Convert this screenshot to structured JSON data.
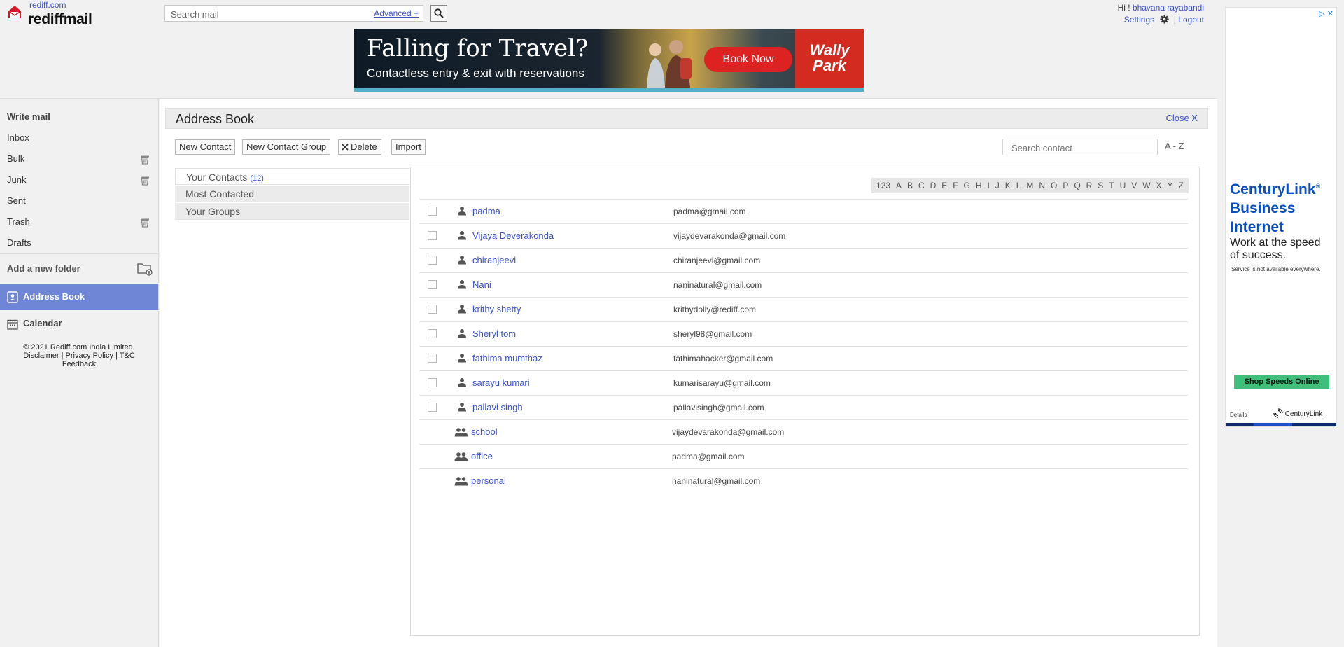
{
  "header": {
    "brand_small": "rediff.com",
    "brand_main": "rediffmail",
    "search_placeholder": "Search mail",
    "advanced_label": "Advanced +",
    "greeting": "Hi !",
    "user_name": "bhavana rayabandi",
    "settings_label": "Settings",
    "separator": "|",
    "logout_label": "Logout"
  },
  "top_ad": {
    "title": "Falling for Travel?",
    "subtitle": "Contactless entry & exit with reservations",
    "cta": "Book Now",
    "brand_line1": "Wally",
    "brand_line2": "Park"
  },
  "sidebar": {
    "write_mail": "Write mail",
    "items": [
      {
        "label": "Inbox",
        "trash": false
      },
      {
        "label": "Bulk",
        "trash": true
      },
      {
        "label": "Junk",
        "trash": true
      },
      {
        "label": "Sent",
        "trash": false
      },
      {
        "label": "Trash",
        "trash": true
      },
      {
        "label": "Drafts",
        "trash": false
      }
    ],
    "add_folder": "Add a new folder",
    "address_book": "Address Book",
    "calendar": "Calendar",
    "copyright": "© 2021 Rediff.com India Limited.",
    "disclaimer": "Disclaimer",
    "privacy": "Privacy Policy",
    "tc": "T&C",
    "feedback": "Feedback",
    "pipe": "|"
  },
  "address_book": {
    "title": "Address Book",
    "close_label": "Close X",
    "toolbar": {
      "new_contact": "New Contact",
      "new_group": "New Contact Group",
      "delete": "Delete",
      "import": "Import"
    },
    "search_placeholder": "Search contact",
    "sort_label": "A - Z",
    "tabs": {
      "your_contacts": "Your Contacts",
      "your_contacts_count": "(12)",
      "most_contacted": "Most Contacted",
      "your_groups": "Your Groups"
    },
    "alphabet": [
      "123",
      "A",
      "B",
      "C",
      "D",
      "E",
      "F",
      "G",
      "H",
      "I",
      "J",
      "K",
      "L",
      "M",
      "N",
      "O",
      "P",
      "Q",
      "R",
      "S",
      "T",
      "U",
      "V",
      "W",
      "X",
      "Y",
      "Z"
    ],
    "contacts": [
      {
        "name": "padma",
        "email": "padma@gmail.com",
        "type": "person"
      },
      {
        "name": "Vijaya Deverakonda",
        "email": "vijaydevarakonda@gmail.com",
        "type": "person"
      },
      {
        "name": "chiranjeevi",
        "email": "chiranjeevi@gmail.com",
        "type": "person"
      },
      {
        "name": "Nani",
        "email": "naninatural@gmail.com",
        "type": "person"
      },
      {
        "name": "krithy shetty",
        "email": "krithydolly@rediff.com",
        "type": "person"
      },
      {
        "name": "Sheryl tom",
        "email": "sheryl98@gmail.com",
        "type": "person"
      },
      {
        "name": "fathima mumthaz",
        "email": "fathimahacker@gmail.com",
        "type": "person"
      },
      {
        "name": "sarayu kumari",
        "email": "kumarisarayu@gmail.com",
        "type": "person"
      },
      {
        "name": "pallavi singh",
        "email": "pallavisingh@gmail.com",
        "type": "person"
      },
      {
        "name": "school",
        "email": "vijaydevarakonda@gmail.com",
        "type": "group"
      },
      {
        "name": "office",
        "email": "padma@gmail.com",
        "type": "group"
      },
      {
        "name": "personal",
        "email": "naninatural@gmail.com",
        "type": "group"
      }
    ]
  },
  "right_ad": {
    "adchoices": "▷ ✕",
    "headline_1": "CenturyLink",
    "headline_reg": "®",
    "headline_2": "Business",
    "headline_3": "Internet",
    "sub_1": "Work at the speed",
    "sub_2": "of success.",
    "note": "Service is not available everywhere.",
    "cta": "Shop Speeds Online",
    "details": "Details",
    "logo_text": "CenturyLink"
  },
  "colors": {
    "link": "#3a53c5",
    "selected_nav": "#6f85d6",
    "ad_red": "#d32b1f",
    "centurylink_blue": "#0a4fbf",
    "centurylink_green": "#3fbf7a"
  }
}
